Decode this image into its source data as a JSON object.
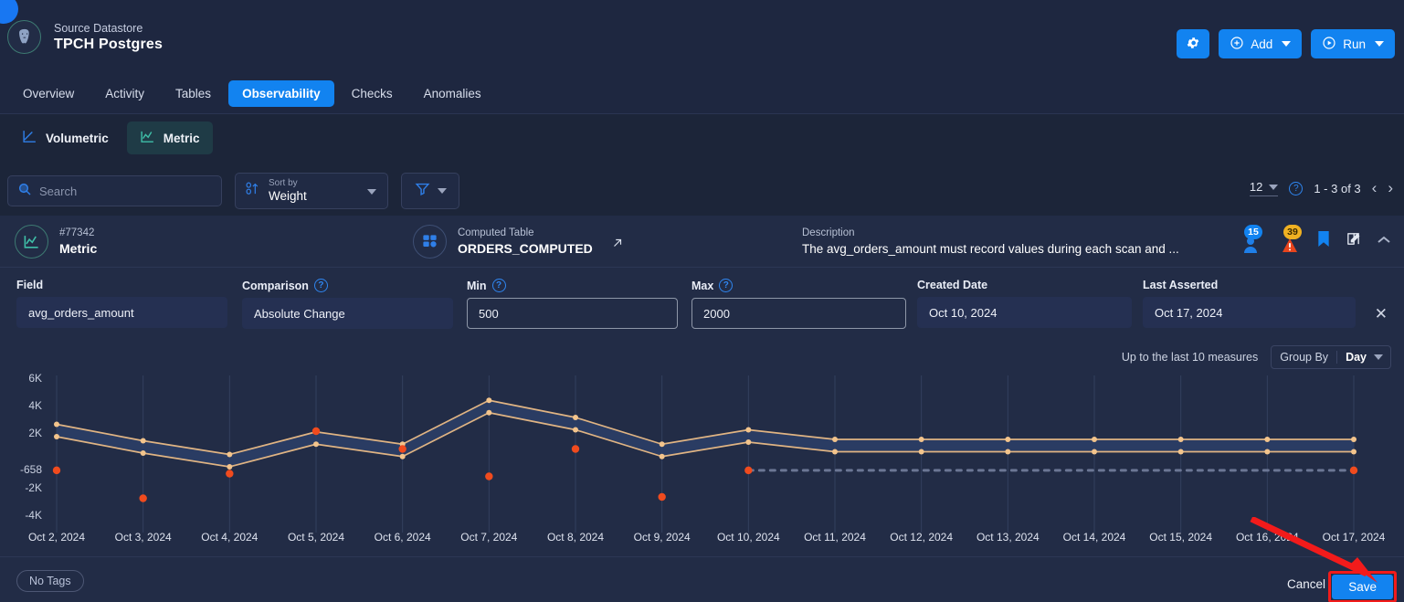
{
  "header": {
    "corner_badge": "",
    "datastore_label": "Source Datastore",
    "datastore_name": "TPCH Postgres",
    "logo_icon": "postgres-elephant-icon",
    "settings_icon": "gear-icon",
    "add_label": "Add",
    "add_icon": "plus-circle-icon",
    "run_label": "Run",
    "run_icon": "play-circle-icon"
  },
  "tabs": [
    {
      "label": "Overview",
      "active": false
    },
    {
      "label": "Activity",
      "active": false
    },
    {
      "label": "Tables",
      "active": false
    },
    {
      "label": "Observability",
      "active": true
    },
    {
      "label": "Checks",
      "active": false
    },
    {
      "label": "Anomalies",
      "active": false
    }
  ],
  "subtabs": [
    {
      "label": "Volumetric",
      "icon": "volumetric-chart-icon",
      "active": false
    },
    {
      "label": "Metric",
      "icon": "metric-chart-icon",
      "active": true
    }
  ],
  "toolbar": {
    "search_placeholder": "Search",
    "search_value": "",
    "search_icon": "search-icon",
    "sort_label": "Sort by",
    "sort_value": "Weight",
    "sort_icon": "sort-numeric-icon",
    "filter_icon": "filter-icon"
  },
  "pagination": {
    "page_size": "12",
    "help_icon": "question-circle-icon",
    "range": "1 - 3 of 3",
    "prev_icon": "chevron-left-icon",
    "next_icon": "chevron-right-icon"
  },
  "card": {
    "metric": {
      "id": "#77342",
      "type": "Metric",
      "icon": "metric-chart-icon"
    },
    "table": {
      "label": "Computed Table",
      "name": "ORDERS_COMPUTED",
      "icon": "table-computed-icon",
      "external_icon": "external-link-icon"
    },
    "description": {
      "label": "Description",
      "text": "The avg_orders_amount must record values during each scan and ..."
    },
    "badges": [
      {
        "icon": "user-icon",
        "count": "15",
        "color": "#1283f0"
      },
      {
        "icon": "warning-triangle-icon",
        "count": "39",
        "color": "#f0a71a"
      }
    ],
    "actions": [
      {
        "icon": "bookmark-icon"
      },
      {
        "icon": "edit-icon"
      },
      {
        "icon": "chevron-up-icon"
      }
    ]
  },
  "form": {
    "fields": [
      {
        "label": "Field",
        "value": "avg_orders_amount",
        "help": false,
        "bordered": false
      },
      {
        "label": "Comparison",
        "value": "Absolute Change",
        "help": true,
        "bordered": false
      },
      {
        "label": "Min",
        "value": "500",
        "help": true,
        "bordered": true
      },
      {
        "label": "Max",
        "value": "2000",
        "help": true,
        "bordered": true
      },
      {
        "label": "Created Date",
        "value": "Oct 10, 2024",
        "help": false,
        "bordered": false
      },
      {
        "label": "Last Asserted",
        "value": "Oct 17, 2024",
        "help": false,
        "bordered": false
      }
    ],
    "close_icon": "close-icon"
  },
  "measures": {
    "text": "Up to the last 10 measures",
    "group_by_label": "Group By",
    "group_by_value": "Day",
    "caret_icon": "chevron-down-icon"
  },
  "chart_data": {
    "type": "line",
    "title": "",
    "xlabel": "",
    "ylabel": "",
    "ylim": [
      -4000,
      6000
    ],
    "ytick_labels": [
      "6K",
      "4K",
      "2K",
      "-658",
      "-2K",
      "-4K"
    ],
    "ytick_values": [
      6000,
      4000,
      2000,
      -658,
      -2000,
      -4000
    ],
    "grid": true,
    "legend": "none",
    "categories": [
      "Oct 2, 2024",
      "Oct 3, 2024",
      "Oct 4, 2024",
      "Oct 5, 2024",
      "Oct 6, 2024",
      "Oct 7, 2024",
      "Oct 8, 2024",
      "Oct 9, 2024",
      "Oct 10, 2024",
      "Oct 11, 2024",
      "Oct 12, 2024",
      "Oct 13, 2024",
      "Oct 14, 2024",
      "Oct 15, 2024",
      "Oct 16, 2024",
      "Oct 17, 2024"
    ],
    "series": [
      {
        "name": "Upper Bound",
        "color": "#e0b483",
        "values": [
          2700,
          1500,
          500,
          2150,
          1250,
          4450,
          3200,
          1250,
          2300,
          1600,
          1600,
          1600,
          1600,
          1600,
          1600,
          1600
        ]
      },
      {
        "name": "Lower Bound",
        "color": "#e0b483",
        "values": [
          1800,
          600,
          -400,
          1250,
          350,
          3550,
          2300,
          350,
          1400,
          700,
          700,
          700,
          700,
          700,
          700,
          700
        ]
      },
      {
        "name": "Metric Value",
        "color": "#2f7fe8",
        "marker_color": "#f04b1e",
        "values": [
          -658,
          -2700,
          -900,
          2200,
          900,
          -1100,
          900,
          -2600,
          -658,
          null,
          null,
          null,
          null,
          null,
          null,
          null
        ]
      },
      {
        "name": "Projection",
        "color": "#6b7694",
        "style": "dotted",
        "values": [
          null,
          null,
          null,
          null,
          null,
          null,
          null,
          null,
          -658,
          -658,
          -658,
          -658,
          -658,
          -658,
          -658,
          -658
        ]
      }
    ]
  },
  "footer": {
    "tags_label": "No Tags",
    "cancel_label": "Cancel",
    "save_label": "Save",
    "highlight_color": "#f21b1b"
  }
}
